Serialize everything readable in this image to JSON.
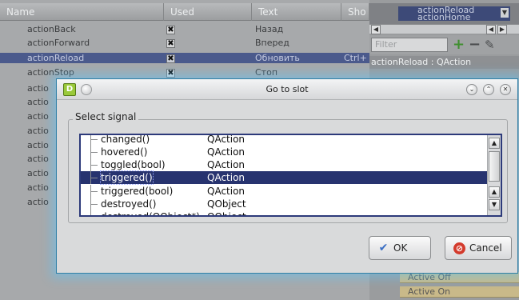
{
  "background_editor": {
    "headers": [
      "Name",
      "Used",
      "Text",
      "Sho"
    ],
    "rows": [
      {
        "name": "actionBack",
        "used": "✖",
        "text": "Назад",
        "shortcut": ""
      },
      {
        "name": "actionForward",
        "used": "✖",
        "text": "Вперед",
        "shortcut": ""
      },
      {
        "name": "actionReload",
        "used": "✖",
        "text": "Обновить",
        "shortcut": "Ctrl+"
      },
      {
        "name": "actionStop",
        "used": "✖",
        "text": "Стоп",
        "shortcut": ""
      }
    ],
    "partial_rows": [
      "actio",
      "actio",
      "actio",
      "actio",
      "actio",
      "actio",
      "actio",
      "actio",
      "actio",
      "actio"
    ]
  },
  "right_panel": {
    "combo_line1": "actionReload",
    "combo_line2": "actionHome",
    "filter_placeholder": "Filter",
    "object_label": "actionReload : QAction",
    "properties": [
      "Active Off",
      "Active On"
    ]
  },
  "dialog": {
    "title": "Go to slot",
    "app_icon_letter": "D",
    "group_title": "Select signal",
    "signals": [
      {
        "signal": "changed()",
        "class": "QAction"
      },
      {
        "signal": "hovered()",
        "class": "QAction"
      },
      {
        "signal": "toggled(bool)",
        "class": "QAction"
      },
      {
        "signal": "triggered()",
        "class": "QAction"
      },
      {
        "signal": "triggered(bool)",
        "class": "QAction"
      },
      {
        "signal": "destroyed()",
        "class": "QObject"
      },
      {
        "signal": "destroyed(QObject*)",
        "class": "QObject"
      }
    ],
    "selected_index": 3,
    "ok_label": "OK",
    "cancel_label": "Cancel"
  },
  "colors": {
    "selection": "#27336f",
    "dialog_glow": "#5ac8ff",
    "cancel_icon": "#d33a2c",
    "ok_icon": "#3b6fc4"
  }
}
